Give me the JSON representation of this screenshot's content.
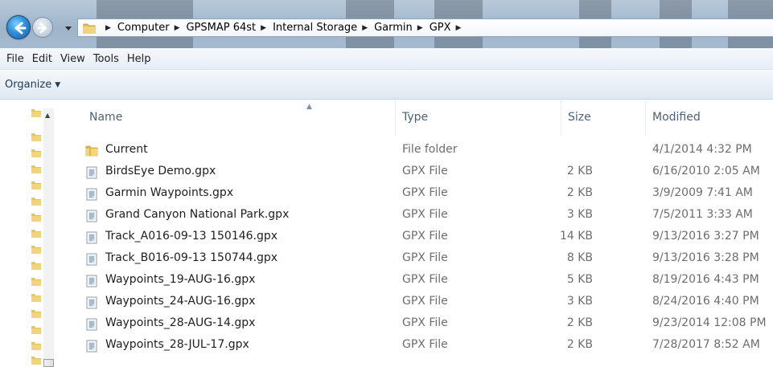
{
  "address": {
    "crumbs": [
      "Computer",
      "GPSMAP 64st",
      "Internal Storage",
      "Garmin",
      "GPX"
    ]
  },
  "menu": {
    "items": [
      "File",
      "Edit",
      "View",
      "Tools",
      "Help"
    ]
  },
  "command_bar": {
    "organize_label": "Organize"
  },
  "columns": {
    "name": "Name",
    "type": "Type",
    "size": "Size",
    "modified": "Modified"
  },
  "files": [
    {
      "name": "Current",
      "type": "File folder",
      "size": "",
      "modified": "4/1/2014 4:32 PM",
      "icon": "folder-icon"
    },
    {
      "name": "BirdsEye Demo.gpx",
      "type": "GPX File",
      "size": "2 KB",
      "modified": "6/16/2010 2:05 AM",
      "icon": "file-icon"
    },
    {
      "name": "Garmin Waypoints.gpx",
      "type": "GPX File",
      "size": "2 KB",
      "modified": "3/9/2009 7:41 AM",
      "icon": "file-icon"
    },
    {
      "name": "Grand Canyon National Park.gpx",
      "type": "GPX File",
      "size": "3 KB",
      "modified": "7/5/2011 3:33 AM",
      "icon": "file-icon"
    },
    {
      "name": "Track_A016-09-13 150146.gpx",
      "type": "GPX File",
      "size": "14 KB",
      "modified": "9/13/2016 3:27 PM",
      "icon": "file-icon"
    },
    {
      "name": "Track_B016-09-13 150744.gpx",
      "type": "GPX File",
      "size": "8 KB",
      "modified": "9/13/2016 3:28 PM",
      "icon": "file-icon"
    },
    {
      "name": "Waypoints_19-AUG-16.gpx",
      "type": "GPX File",
      "size": "5 KB",
      "modified": "8/19/2016 4:43 PM",
      "icon": "file-icon"
    },
    {
      "name": "Waypoints_24-AUG-16.gpx",
      "type": "GPX File",
      "size": "3 KB",
      "modified": "8/24/2016 4:40 PM",
      "icon": "file-icon"
    },
    {
      "name": "Waypoints_28-AUG-14.gpx",
      "type": "GPX File",
      "size": "2 KB",
      "modified": "9/23/2014 12:08 PM",
      "icon": "file-icon"
    },
    {
      "name": "Waypoints_28-JUL-17.gpx",
      "type": "GPX File",
      "size": "2 KB",
      "modified": "7/28/2017 8:52 AM",
      "icon": "file-icon"
    }
  ],
  "colors": {
    "secondary_text": "#6d6d6d",
    "header_text": "#4c607a",
    "command_text": "#1e395b"
  }
}
